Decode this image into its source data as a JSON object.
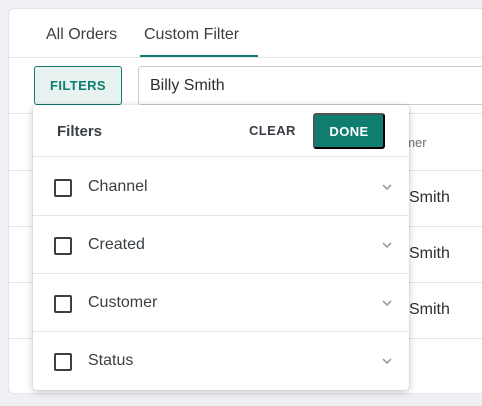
{
  "tabs": [
    {
      "label": "All Orders"
    },
    {
      "label": "Custom Filter"
    }
  ],
  "toolbar": {
    "filters_label": "FILTERS",
    "search_value": "Billy Smith"
  },
  "table": {
    "column_header_partial": "omer",
    "rows": [
      {
        "customer_partial": "Smith"
      },
      {
        "customer_partial": "Smith"
      },
      {
        "customer_partial": "Smith"
      }
    ]
  },
  "filters_dropdown": {
    "title": "Filters",
    "clear_label": "CLEAR",
    "done_label": "DONE",
    "items": [
      {
        "label": "Channel",
        "checked": false
      },
      {
        "label": "Created",
        "checked": false
      },
      {
        "label": "Customer",
        "checked": false
      },
      {
        "label": "Status",
        "checked": false
      }
    ]
  },
  "colors": {
    "accent": "#0f7d6f",
    "accent_light": "#e8f2f1",
    "border": "#e3e6e9"
  },
  "icons": {
    "item_chevron": "chevron-down-icon",
    "checkbox": "checkbox-unchecked-icon"
  }
}
